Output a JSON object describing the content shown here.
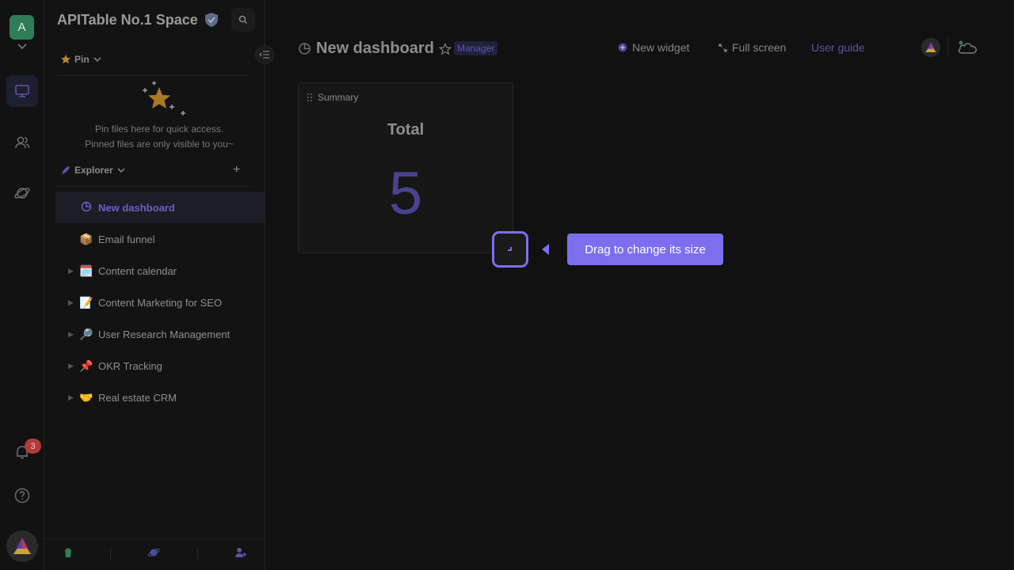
{
  "space": {
    "initial": "A",
    "name": "APITable No.1 Space",
    "notification_count": "3"
  },
  "pin": {
    "label": "Pin",
    "empty_line1": "Pin files here for quick access.",
    "empty_line2": "Pinned files are only visible to you~"
  },
  "explorer": {
    "label": "Explorer",
    "add_icon": "+",
    "items": [
      {
        "label": "New dashboard",
        "icon": "dashboard-icon",
        "active": true
      },
      {
        "label": "Email funnel",
        "emoji": "📦"
      },
      {
        "label": "Content calendar",
        "emoji": "🗓️"
      },
      {
        "label": "Content Marketing for SEO",
        "emoji": "📝"
      },
      {
        "label": "User Research Management",
        "emoji": "🔎"
      },
      {
        "label": "OKR Tracking",
        "emoji": "📌"
      },
      {
        "label": "Real estate CRM",
        "emoji": "🤝"
      }
    ]
  },
  "dashboard": {
    "title": "New dashboard",
    "role": "Manager",
    "new_widget": "New widget",
    "full_screen": "Full screen",
    "user_guide": "User guide"
  },
  "widget": {
    "title": "Summary",
    "label": "Total",
    "value": "5"
  },
  "tour": {
    "tip": "Drag to change its size"
  },
  "colors": {
    "accent": "#7b6ff0",
    "space_avatar": "#2f7d57",
    "badge": "#b23a3a"
  }
}
